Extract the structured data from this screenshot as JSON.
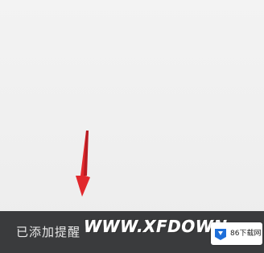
{
  "notification": {
    "message": "已添加提醒"
  },
  "watermark": {
    "text": "WWW.XFDOWN"
  },
  "logo": {
    "text": "86下载网",
    "icon": "download-logo-icon"
  },
  "colors": {
    "background": "#f1f1f1",
    "toast_bar": "#3a3b3d",
    "arrow": "#e1282c",
    "logo_blue": "#1e6fd9"
  }
}
